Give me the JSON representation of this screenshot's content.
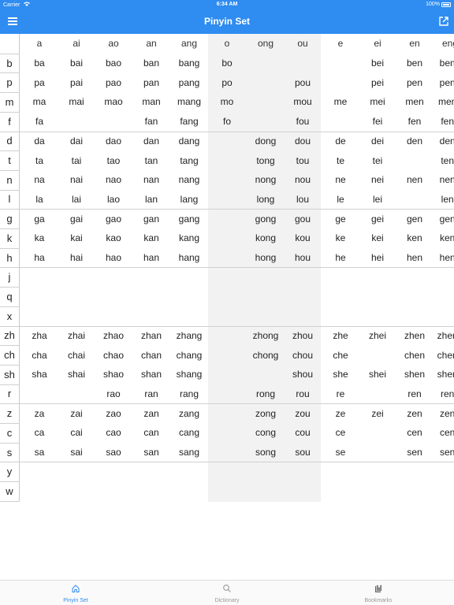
{
  "status_bar": {
    "carrier": "Carrier",
    "time": "6:34 AM",
    "battery": "100%"
  },
  "nav": {
    "title": "Pinyin Set",
    "menu_icon": "hamburger-menu-icon",
    "export_icon": "external-link-icon"
  },
  "colors": {
    "accent": "#2f8cf0",
    "shade": "#f2f2f2"
  },
  "finals": [
    "a",
    "ai",
    "ao",
    "an",
    "ang",
    "o",
    "ong",
    "ou",
    "e",
    "ei",
    "en",
    "eng"
  ],
  "initials": [
    "b",
    "p",
    "m",
    "f",
    "d",
    "t",
    "n",
    "l",
    "g",
    "k",
    "h",
    "j",
    "q",
    "x",
    "zh",
    "ch",
    "sh",
    "r",
    "z",
    "c",
    "s",
    "y",
    "w"
  ],
  "group_breaks_after": [
    "f",
    "l",
    "h",
    "x",
    "r",
    "s"
  ],
  "rows": [
    [
      "ba",
      "bai",
      "bao",
      "ban",
      "bang",
      "bo",
      "",
      "",
      "",
      "bei",
      "ben",
      "beng"
    ],
    [
      "pa",
      "pai",
      "pao",
      "pan",
      "pang",
      "po",
      "",
      "pou",
      "",
      "pei",
      "pen",
      "peng"
    ],
    [
      "ma",
      "mai",
      "mao",
      "man",
      "mang",
      "mo",
      "",
      "mou",
      "me",
      "mei",
      "men",
      "meng"
    ],
    [
      "fa",
      "",
      "",
      "fan",
      "fang",
      "fo",
      "",
      "fou",
      "",
      "fei",
      "fen",
      "feng"
    ],
    [
      "da",
      "dai",
      "dao",
      "dan",
      "dang",
      "",
      "dong",
      "dou",
      "de",
      "dei",
      "den",
      "deng"
    ],
    [
      "ta",
      "tai",
      "tao",
      "tan",
      "tang",
      "",
      "tong",
      "tou",
      "te",
      "tei",
      "",
      "teng"
    ],
    [
      "na",
      "nai",
      "nao",
      "nan",
      "nang",
      "",
      "nong",
      "nou",
      "ne",
      "nei",
      "nen",
      "neng"
    ],
    [
      "la",
      "lai",
      "lao",
      "lan",
      "lang",
      "",
      "long",
      "lou",
      "le",
      "lei",
      "",
      "leng"
    ],
    [
      "ga",
      "gai",
      "gao",
      "gan",
      "gang",
      "",
      "gong",
      "gou",
      "ge",
      "gei",
      "gen",
      "geng"
    ],
    [
      "ka",
      "kai",
      "kao",
      "kan",
      "kang",
      "",
      "kong",
      "kou",
      "ke",
      "kei",
      "ken",
      "keng"
    ],
    [
      "ha",
      "hai",
      "hao",
      "han",
      "hang",
      "",
      "hong",
      "hou",
      "he",
      "hei",
      "hen",
      "heng"
    ],
    [
      "",
      "",
      "",
      "",
      "",
      "",
      "",
      "",
      "",
      "",
      "",
      ""
    ],
    [
      "",
      "",
      "",
      "",
      "",
      "",
      "",
      "",
      "",
      "",
      "",
      ""
    ],
    [
      "",
      "",
      "",
      "",
      "",
      "",
      "",
      "",
      "",
      "",
      "",
      ""
    ],
    [
      "zha",
      "zhai",
      "zhao",
      "zhan",
      "zhang",
      "",
      "zhong",
      "zhou",
      "zhe",
      "zhei",
      "zhen",
      "zheng"
    ],
    [
      "cha",
      "chai",
      "chao",
      "chan",
      "chang",
      "",
      "chong",
      "chou",
      "che",
      "",
      "chen",
      "cheng"
    ],
    [
      "sha",
      "shai",
      "shao",
      "shan",
      "shang",
      "",
      "",
      "shou",
      "she",
      "shei",
      "shen",
      "sheng"
    ],
    [
      "",
      "",
      "rao",
      "ran",
      "rang",
      "",
      "rong",
      "rou",
      "re",
      "",
      "ren",
      "reng"
    ],
    [
      "za",
      "zai",
      "zao",
      "zan",
      "zang",
      "",
      "zong",
      "zou",
      "ze",
      "zei",
      "zen",
      "zeng"
    ],
    [
      "ca",
      "cai",
      "cao",
      "can",
      "cang",
      "",
      "cong",
      "cou",
      "ce",
      "",
      "cen",
      "ceng"
    ],
    [
      "sa",
      "sai",
      "sao",
      "san",
      "sang",
      "",
      "song",
      "sou",
      "se",
      "",
      "sen",
      "seng"
    ],
    [
      "",
      "",
      "",
      "",
      "",
      "",
      "",
      "",
      "",
      "",
      "",
      ""
    ],
    [
      "",
      "",
      "",
      "",
      "",
      "",
      "",
      "",
      "",
      "",
      "",
      ""
    ]
  ],
  "tabs": [
    {
      "label": "Pinyin Set",
      "icon": "home-icon",
      "active": true
    },
    {
      "label": "Dictionary",
      "icon": "search-icon",
      "active": false
    },
    {
      "label": "Bookmarks",
      "icon": "bookmarks-icon",
      "active": false
    }
  ]
}
